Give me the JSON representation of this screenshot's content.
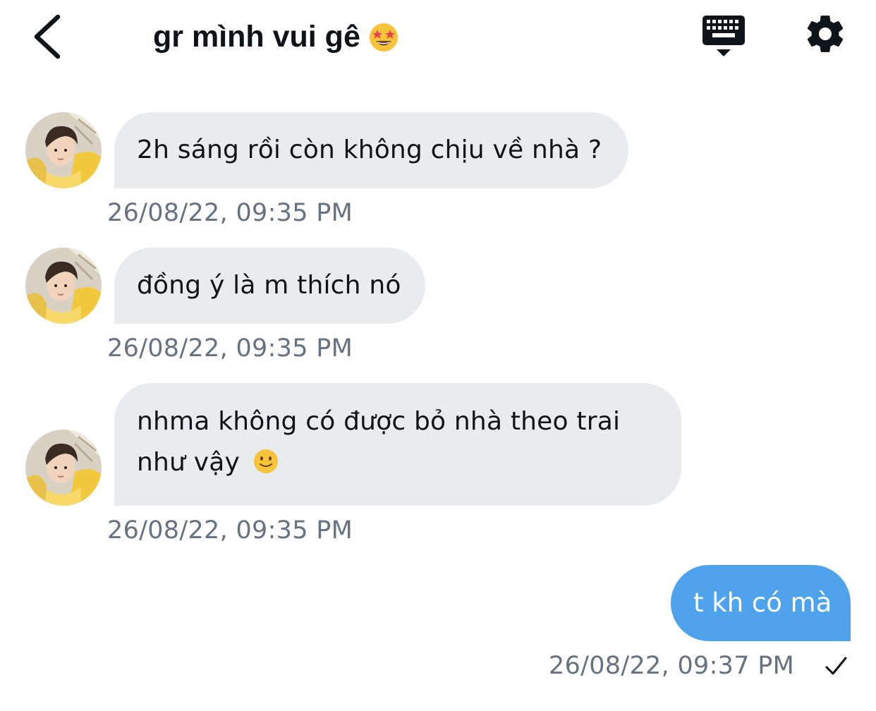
{
  "header": {
    "title": "gr mình vui gê",
    "title_emoji": "star-struck-emoji",
    "back_icon": "chevron-left-icon",
    "keyboard_icon": "keyboard-icon",
    "settings_icon": "gear-icon"
  },
  "messages": [
    {
      "direction": "incoming",
      "text": "2h sáng rồi còn không chịu về nhà ?",
      "timestamp": "26/08/22, 09:35 PM"
    },
    {
      "direction": "incoming",
      "text": "đồng ý là m thích nó",
      "timestamp": "26/08/22, 09:35 PM"
    },
    {
      "direction": "incoming",
      "line1": "nhma không có được bỏ nhà theo trai",
      "line2": "như vậy",
      "emoji": "slightly-smiling-face-emoji",
      "timestamp": "26/08/22, 09:35 PM"
    },
    {
      "direction": "outgoing",
      "text": "t kh có mà",
      "timestamp": "26/08/22, 09:37 PM",
      "status_icon": "check-icon"
    }
  ],
  "colors": {
    "incoming_bubble": "#e9ecef",
    "outgoing_bubble": "#4ea3ec",
    "timestamp": "#66727f",
    "text": "#0f1419"
  }
}
